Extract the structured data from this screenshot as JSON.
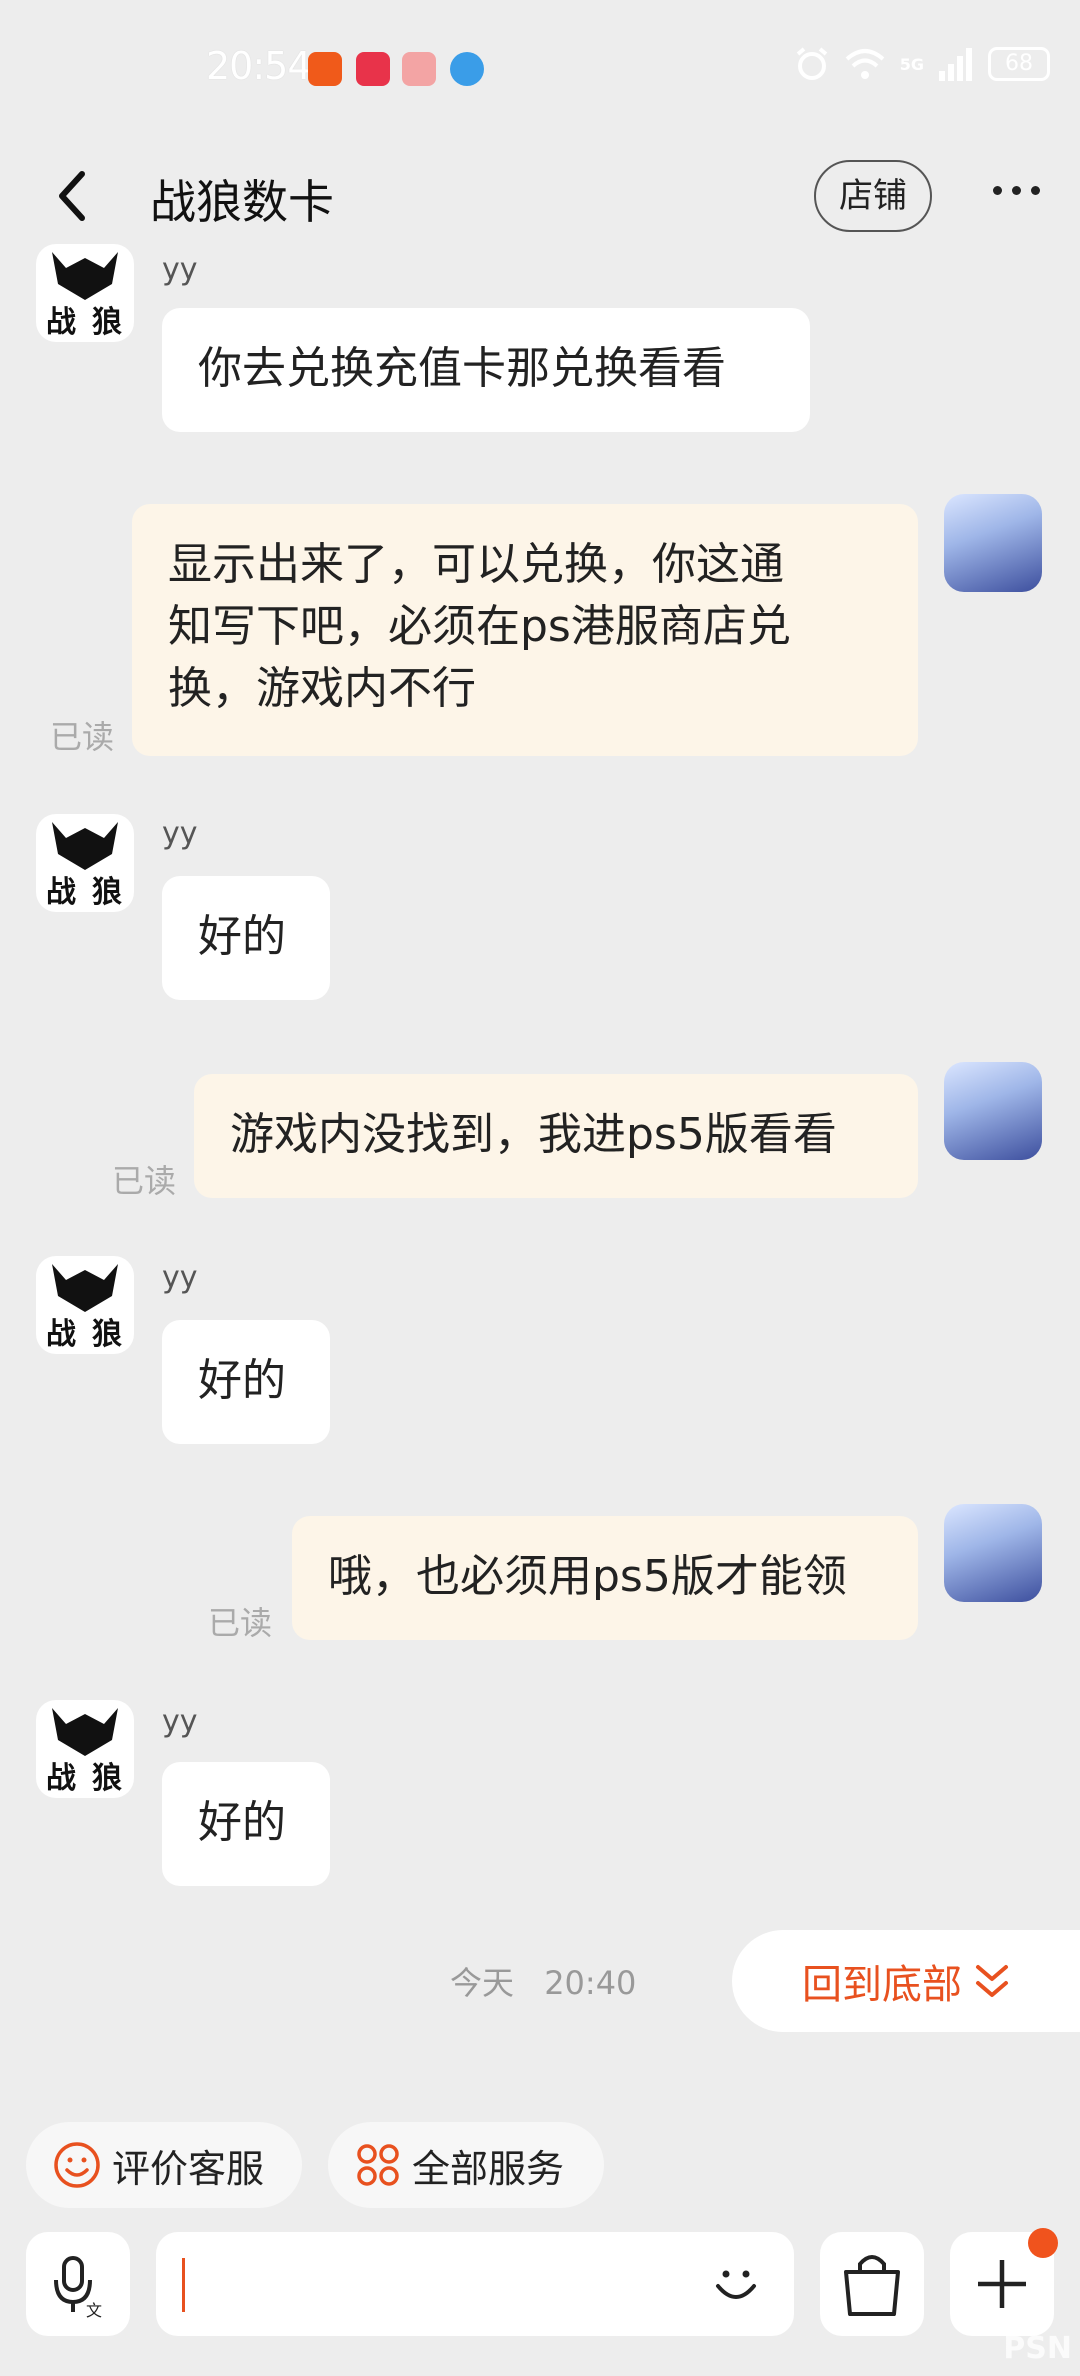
{
  "status_bar": {
    "time": "20:54",
    "battery": "68",
    "network": "5G"
  },
  "header": {
    "title": "战狼数卡",
    "shop_label": "店铺"
  },
  "messages": [
    {
      "sender": "yy",
      "text": "你去兑换充值卡那兑换看看"
    },
    {
      "text_lines": [
        "显示出来了，可以兑换，你这通",
        "知写下吧，必须在ps港服商店兑",
        "换，游戏内不行"
      ],
      "status": "已读"
    },
    {
      "sender": "yy",
      "text": "好的"
    },
    {
      "text": "游戏内没找到，我进ps5版看看",
      "status": "已读"
    },
    {
      "sender": "yy",
      "text": "好的"
    },
    {
      "text": "哦，也必须用ps5版才能领",
      "status": "已读"
    },
    {
      "sender": "yy",
      "text": "好的"
    }
  ],
  "timestamp": {
    "day": "今天",
    "time": "20:40"
  },
  "jump_to_bottom": "回到底部",
  "quick_actions": {
    "rate": "评价客服",
    "all_services": "全部服务"
  },
  "avatar_text": {
    "top": "战",
    "bottom": "狼"
  },
  "watermark": "PSN",
  "colors": {
    "accent": "#e8511f",
    "outgoing_bubble": "#fdf5e8",
    "incoming_bubble": "#ffffff",
    "background": "#ededed"
  }
}
